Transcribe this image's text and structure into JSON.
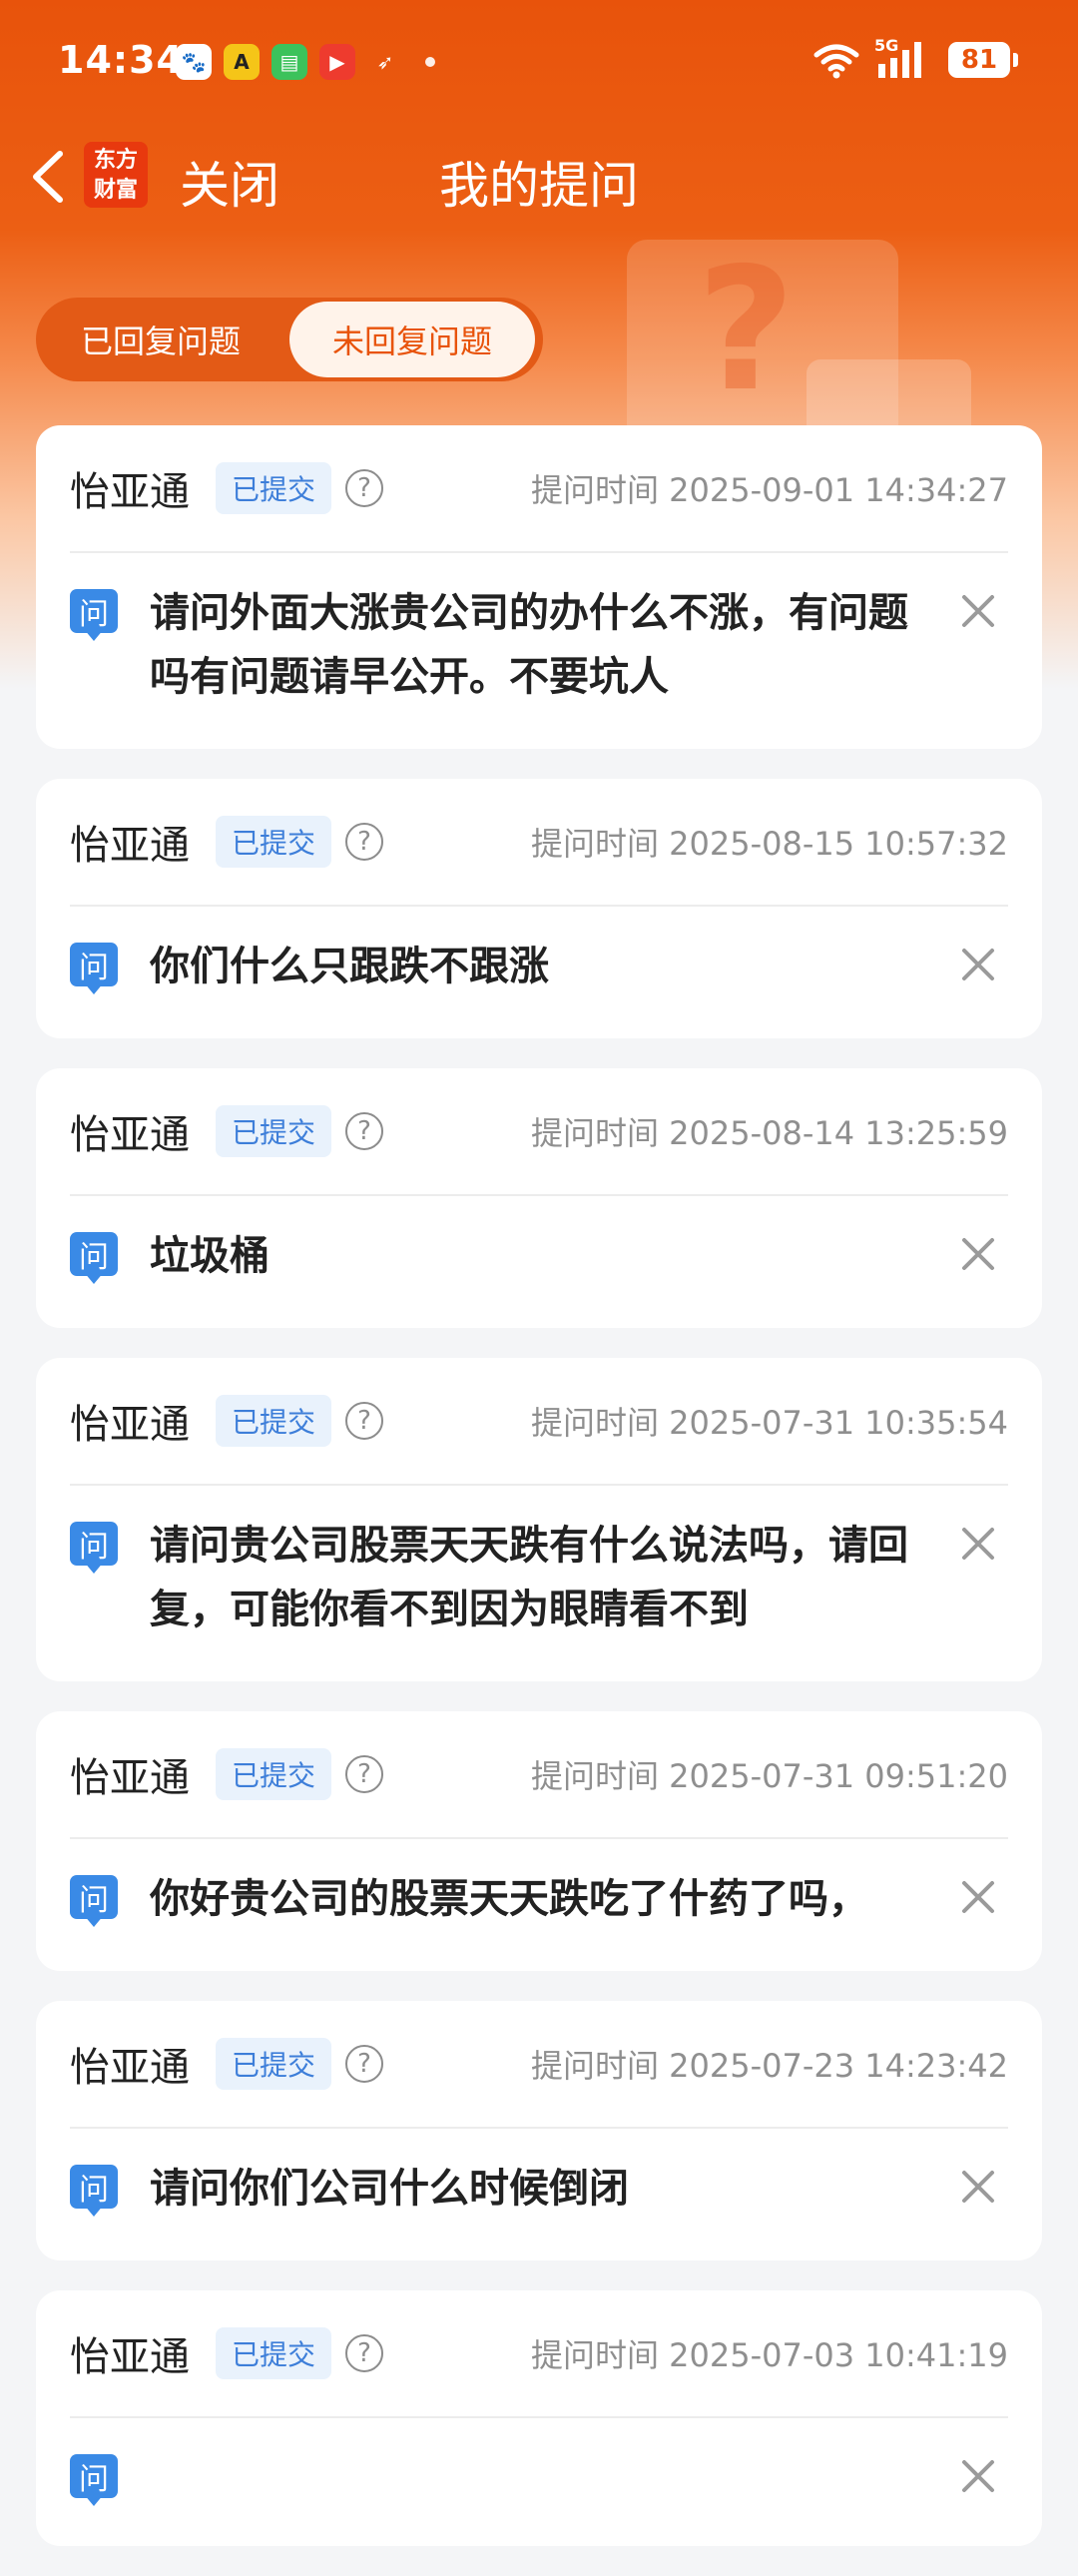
{
  "status_bar": {
    "time": "14:34",
    "battery": "81",
    "network": "5G"
  },
  "nav": {
    "logo_line1": "东方",
    "logo_line2": "财富",
    "close_label": "关闭",
    "title": "我的提问"
  },
  "tabs": {
    "replied": "已回复问题",
    "unreplied": "未回复问题",
    "active": "unreplied"
  },
  "questions": [
    {
      "company": "怡亚通",
      "status": "已提交",
      "time": "提问时间 2025-09-01 14:34:27",
      "text": "请问外面大涨贵公司的办什么不涨，有问题吗有问题请早公开。不要坑人"
    },
    {
      "company": "怡亚通",
      "status": "已提交",
      "time": "提问时间 2025-08-15 10:57:32",
      "text": "你们什么只跟跌不跟涨"
    },
    {
      "company": "怡亚通",
      "status": "已提交",
      "time": "提问时间 2025-08-14 13:25:59",
      "text": "垃圾桶"
    },
    {
      "company": "怡亚通",
      "status": "已提交",
      "time": "提问时间 2025-07-31 10:35:54",
      "text": "请问贵公司股票天天跌有什么说法吗，请回复，可能你看不到因为眼睛看不到"
    },
    {
      "company": "怡亚通",
      "status": "已提交",
      "time": "提问时间 2025-07-31 09:51:20",
      "text": "你好贵公司的股票天天跌吃了什药了吗，"
    },
    {
      "company": "怡亚通",
      "status": "已提交",
      "time": "提问时间 2025-07-23 14:23:42",
      "text": "请问你们公司什么时候倒闭"
    },
    {
      "company": "怡亚通",
      "status": "已提交",
      "time": "提问时间 2025-07-03 10:41:19",
      "text": ""
    }
  ],
  "question_icon_char": "问",
  "colors": {
    "brand": "#e8530b",
    "badge_text": "#3d7ed9",
    "badge_bg": "#e9f2fc",
    "question_icon": "#3a8ae6"
  }
}
